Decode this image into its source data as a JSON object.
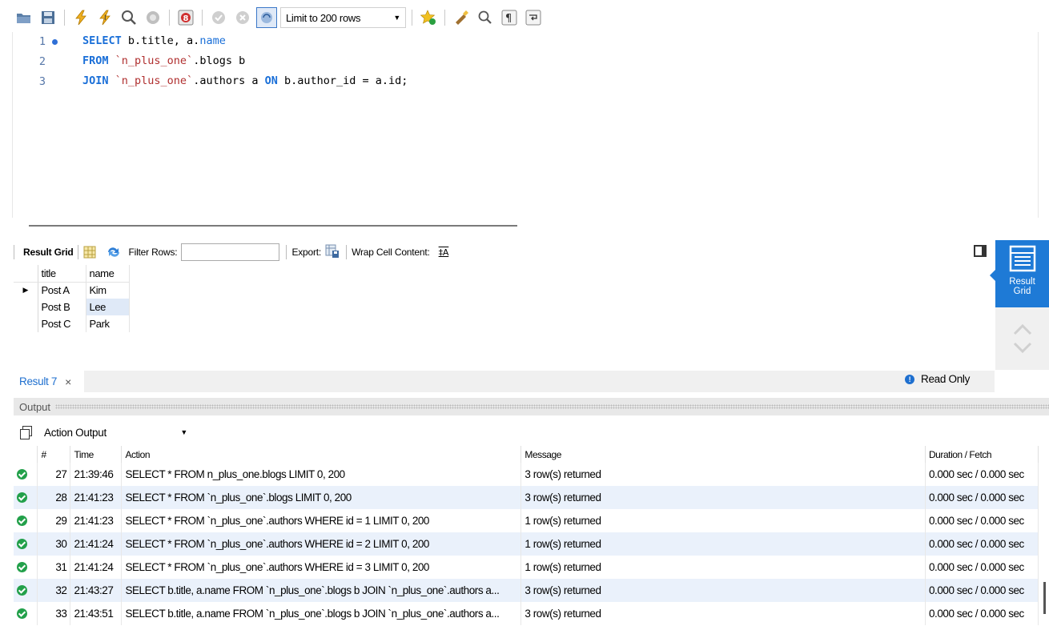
{
  "toolbar": {
    "limit_select": "Limit to 200 rows",
    "icons": [
      "open-folder-icon",
      "save-icon",
      "execute-icon",
      "execute-current-icon",
      "explain-icon",
      "stop-icon",
      "toggle-errors-icon",
      "commit-icon",
      "rollback-icon",
      "autocommit-icon",
      "bookmark-icon",
      "beautify-icon",
      "find-icon",
      "invisible-chars-icon",
      "wrap-icon"
    ]
  },
  "editor": {
    "lines": [
      {
        "num": "1",
        "parts": [
          {
            "t": "SELECT",
            "c": "kw"
          },
          {
            "t": " b.title, a.",
            "c": ""
          },
          {
            "t": "name",
            "c": "fn"
          }
        ]
      },
      {
        "num": "2",
        "parts": [
          {
            "t": "FROM",
            "c": "kw"
          },
          {
            "t": " ",
            "c": ""
          },
          {
            "t": "`n_plus_one`",
            "c": "str"
          },
          {
            "t": ".blogs b",
            "c": ""
          }
        ]
      },
      {
        "num": "3",
        "parts": [
          {
            "t": "JOIN",
            "c": "kw"
          },
          {
            "t": " ",
            "c": ""
          },
          {
            "t": "`n_plus_one`",
            "c": "str"
          },
          {
            "t": ".authors a ",
            "c": ""
          },
          {
            "t": "ON",
            "c": "kw"
          },
          {
            "t": " b.author_id = a.id;",
            "c": ""
          }
        ]
      }
    ]
  },
  "result_toolbar": {
    "result_grid_label": "Result Grid",
    "filter_label": "Filter Rows:",
    "filter_value": "",
    "export_label": "Export:",
    "wrap_label": "Wrap Cell Content:"
  },
  "result_grid": {
    "columns": [
      "title",
      "name"
    ],
    "rows": [
      [
        "Post A",
        "Kim"
      ],
      [
        "Post B",
        "Lee"
      ],
      [
        "Post C",
        "Park"
      ]
    ]
  },
  "side_panel": {
    "label_line1": "Result",
    "label_line2": "Grid"
  },
  "result_tab": {
    "label": "Result 7",
    "close": "×",
    "read_only": "Read Only"
  },
  "output": {
    "title": "Output",
    "mode": "Action Output",
    "columns": [
      "#",
      "Time",
      "Action",
      "Message",
      "Duration / Fetch"
    ],
    "rows": [
      {
        "n": "27",
        "time": "21:39:46",
        "action": "SELECT * FROM n_plus_one.blogs LIMIT 0, 200",
        "msg": "3 row(s) returned",
        "dur": "0.000 sec / 0.000 sec"
      },
      {
        "n": "28",
        "time": "21:41:23",
        "action": "SELECT * FROM `n_plus_one`.blogs LIMIT 0, 200",
        "msg": "3 row(s) returned",
        "dur": "0.000 sec / 0.000 sec"
      },
      {
        "n": "29",
        "time": "21:41:23",
        "action": "SELECT * FROM `n_plus_one`.authors WHERE id = 1 LIMIT 0, 200",
        "msg": "1 row(s) returned",
        "dur": "0.000 sec / 0.000 sec"
      },
      {
        "n": "30",
        "time": "21:41:24",
        "action": "SELECT * FROM `n_plus_one`.authors WHERE id = 2 LIMIT 0, 200",
        "msg": "1 row(s) returned",
        "dur": "0.000 sec / 0.000 sec"
      },
      {
        "n": "31",
        "time": "21:41:24",
        "action": "SELECT * FROM `n_plus_one`.authors WHERE id = 3 LIMIT 0, 200",
        "msg": "1 row(s) returned",
        "dur": "0.000 sec / 0.000 sec"
      },
      {
        "n": "32",
        "time": "21:43:27",
        "action": "SELECT b.title, a.name FROM `n_plus_one`.blogs b JOIN `n_plus_one`.authors a...",
        "msg": "3 row(s) returned",
        "dur": "0.000 sec / 0.000 sec"
      },
      {
        "n": "33",
        "time": "21:43:51",
        "action": "SELECT b.title, a.name FROM `n_plus_one`.blogs b JOIN `n_plus_one`.authors a...",
        "msg": "3 row(s) returned",
        "dur": "0.000 sec / 0.000 sec"
      }
    ]
  },
  "colors": {
    "accent": "#1e7ad6",
    "keyword": "#1a6fd8",
    "string": "#b03030",
    "success": "#22a04a",
    "row_alt": "#eaf1fb"
  }
}
